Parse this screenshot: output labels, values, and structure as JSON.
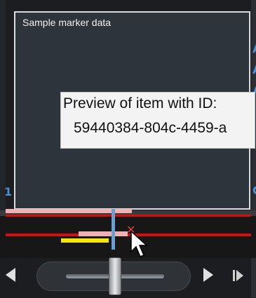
{
  "popup": {
    "title": "Sample marker data"
  },
  "tooltip": {
    "line1": "Preview of item with ID:",
    "line2": "59440384-804c-4459-a"
  },
  "background_hints": {
    "left_digit": "1",
    "right_chars": [
      "A",
      "A",
      "A",
      "C"
    ]
  },
  "timeline": {
    "colors": {
      "marker_red": "#d30f0f",
      "marker_pink": "#f0b3b3",
      "highlight_yellow": "#f4e50a",
      "playhead_blue": "#6a9fd3"
    }
  },
  "controls": {
    "icons": [
      "previous-arrow-icon",
      "shuttle-slider",
      "next-arrow-icon",
      "step-forward-icon"
    ]
  }
}
